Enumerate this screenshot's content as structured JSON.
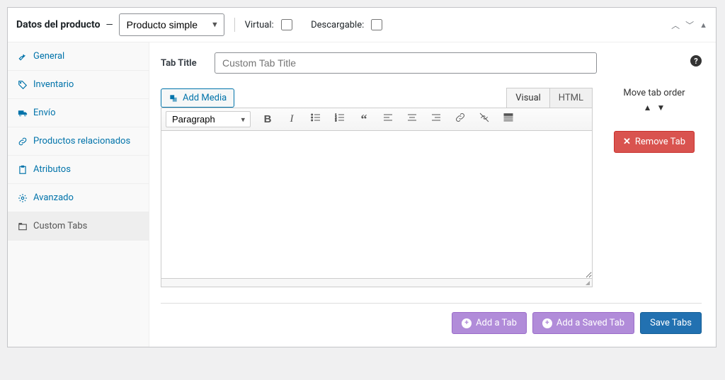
{
  "header": {
    "title": "Datos del producto",
    "type_select": "Producto simple",
    "virtual_label": "Virtual:",
    "download_label": "Descargable:"
  },
  "sidebar": {
    "items": [
      {
        "label": "General",
        "icon": "wrench"
      },
      {
        "label": "Inventario",
        "icon": "tag"
      },
      {
        "label": "Envío",
        "icon": "truck"
      },
      {
        "label": "Productos relacionados",
        "icon": "link"
      },
      {
        "label": "Atributos",
        "icon": "clipboard"
      },
      {
        "label": "Avanzado",
        "icon": "gear"
      },
      {
        "label": "Custom Tabs",
        "icon": "tabs"
      }
    ],
    "active_index": 6
  },
  "main": {
    "title_label": "Tab Title",
    "title_placeholder": "Custom Tab Title",
    "add_media": "Add Media",
    "editor_tabs": {
      "visual": "Visual",
      "html": "HTML"
    },
    "paragraph_select": "Paragraph",
    "move_label": "Move tab order",
    "remove_btn": "Remove Tab"
  },
  "footer": {
    "add_tab": "Add a Tab",
    "add_saved": "Add a Saved Tab",
    "save": "Save Tabs"
  }
}
